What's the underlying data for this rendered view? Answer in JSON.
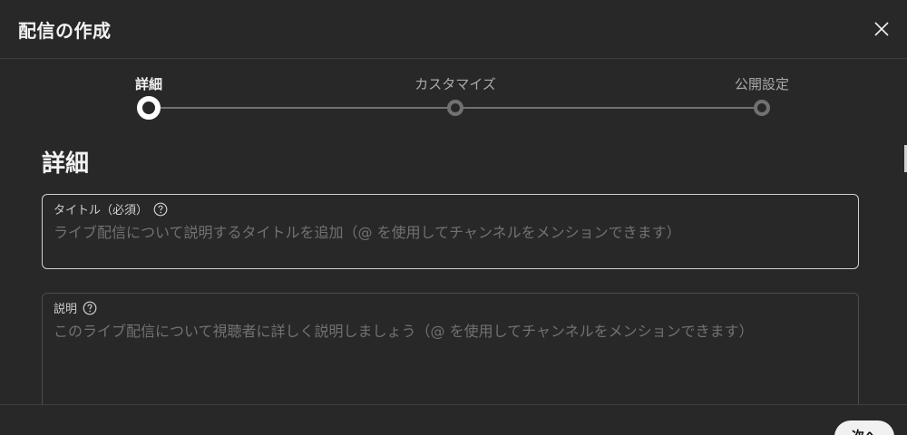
{
  "dialog": {
    "title": "配信の作成",
    "close_icon": "close-icon"
  },
  "stepper": {
    "steps": [
      {
        "label": "詳細",
        "state": "active"
      },
      {
        "label": "カスタマイズ",
        "state": "inactive"
      },
      {
        "label": "公開設定",
        "state": "inactive"
      }
    ]
  },
  "section": {
    "title": "詳細"
  },
  "title_field": {
    "label": "タイトル（必須）",
    "placeholder": "ライブ配信について説明するタイトルを追加（@ を使用してチャンネルをメンションできます）",
    "value": "",
    "help_icon": "help-icon"
  },
  "description_field": {
    "label": "説明",
    "placeholder": "このライブ配信について視聴者に詳しく説明しましょう（@ を使用してチャンネルをメンションできます）",
    "value": "",
    "help_icon": "help-icon"
  },
  "footer": {
    "next_label": "次へ"
  },
  "colors": {
    "background": "#282828",
    "text": "#f1f1f1",
    "muted": "#aaaaaa",
    "placeholder": "#717171",
    "border_active": "#d0d0d0",
    "border_inactive": "#4d4d4d"
  }
}
